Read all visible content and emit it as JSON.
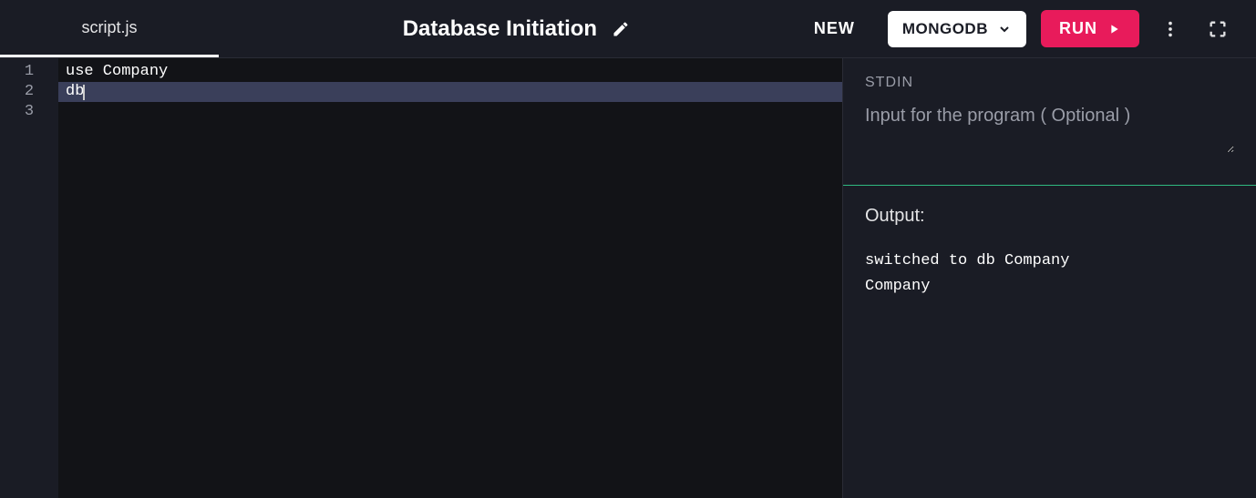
{
  "header": {
    "tab_label": "script.js",
    "title": "Database Initiation",
    "new_label": "NEW",
    "language_label": "MONGODB",
    "run_label": "RUN"
  },
  "editor": {
    "lines": [
      {
        "num": "1",
        "text": "use Company",
        "active": false
      },
      {
        "num": "2",
        "text": "db",
        "active": true
      },
      {
        "num": "3",
        "text": "",
        "active": false
      }
    ]
  },
  "side": {
    "stdin_label": "STDIN",
    "stdin_placeholder": "Input for the program ( Optional )",
    "output_label": "Output:",
    "output_text": "switched to db Company\nCompany"
  },
  "colors": {
    "accent": "#e81b5b",
    "background": "#1a1c25",
    "editor_bg": "#121317",
    "divider_green": "#2FB880"
  }
}
